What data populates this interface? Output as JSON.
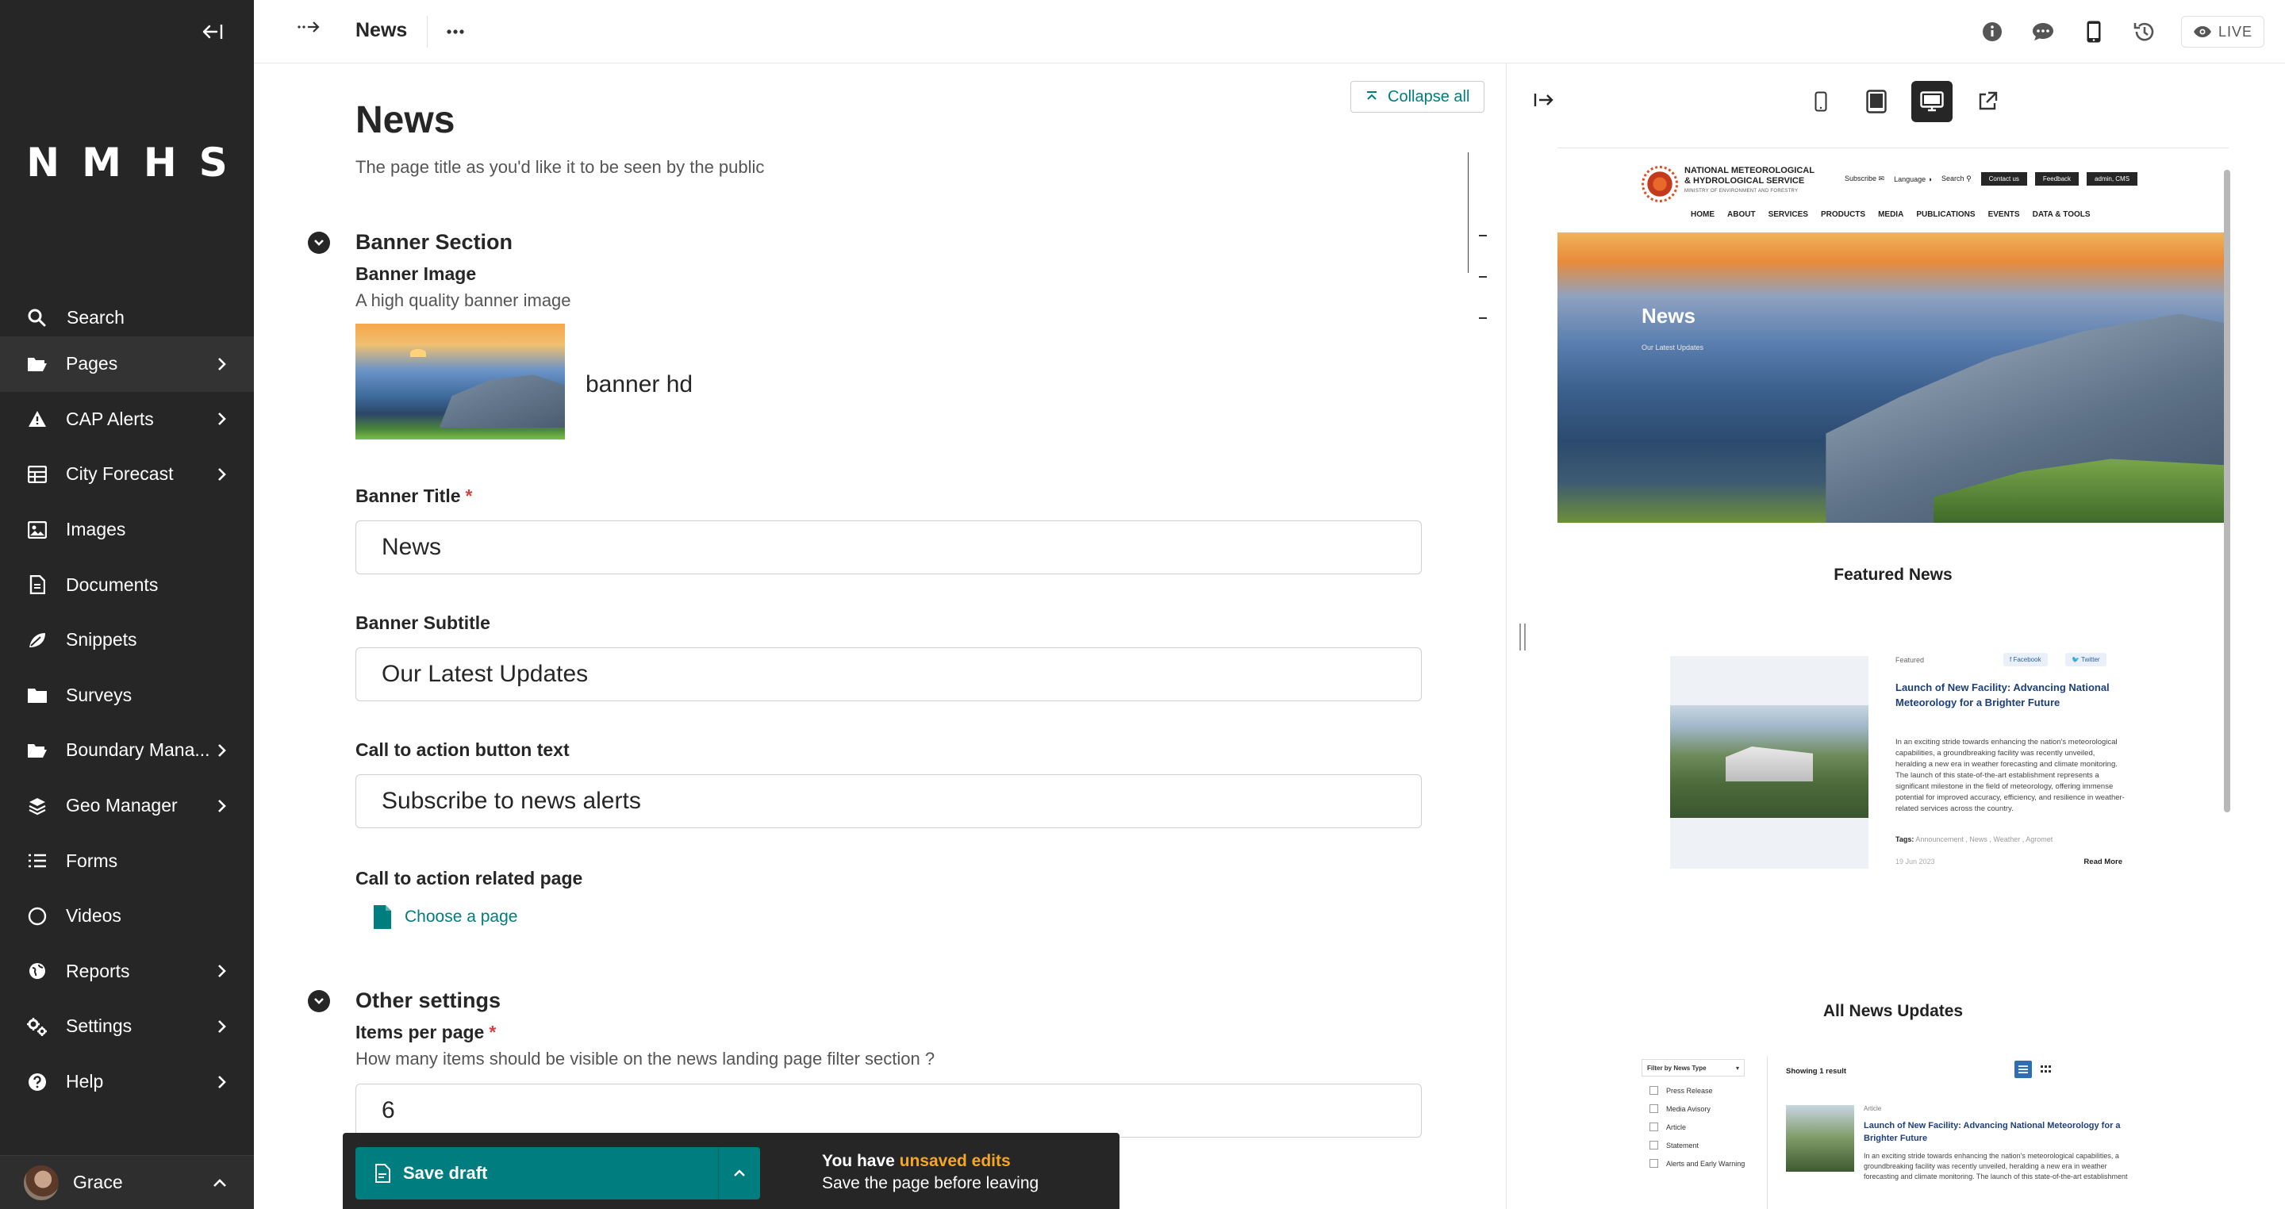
{
  "sidebar": {
    "logo": "NMHS",
    "search_label": "Search",
    "items": [
      {
        "label": "Pages",
        "icon": "folder-open-icon",
        "has_children": true
      },
      {
        "label": "CAP Alerts",
        "icon": "warning-icon",
        "has_children": true
      },
      {
        "label": "City Forecast",
        "icon": "table-icon",
        "has_children": true
      },
      {
        "label": "Images",
        "icon": "image-icon",
        "has_children": false
      },
      {
        "label": "Documents",
        "icon": "document-icon",
        "has_children": false
      },
      {
        "label": "Snippets",
        "icon": "snippet-icon",
        "has_children": false
      },
      {
        "label": "Surveys",
        "icon": "folder-icon",
        "has_children": false
      },
      {
        "label": "Boundary Mana...",
        "icon": "folder-open-icon",
        "has_children": true
      },
      {
        "label": "Geo Manager",
        "icon": "layers-icon",
        "has_children": true
      },
      {
        "label": "Forms",
        "icon": "list-icon",
        "has_children": false
      },
      {
        "label": "Videos",
        "icon": "circle-icon",
        "has_children": false
      },
      {
        "label": "Reports",
        "icon": "globe-icon",
        "has_children": true
      },
      {
        "label": "Settings",
        "icon": "cogs-icon",
        "has_children": true
      },
      {
        "label": "Help",
        "icon": "help-icon",
        "has_children": true
      }
    ],
    "user_name": "Grace"
  },
  "topbar": {
    "title": "News",
    "live_label": "LIVE"
  },
  "editor": {
    "collapse_all": "Collapse all",
    "page_title": "News",
    "page_title_help": "The page title as you'd like it to be seen by the public",
    "banner_section": "Banner Section",
    "banner_image_label": "Banner Image",
    "banner_image_help": "A high quality banner image",
    "banner_image_name": "banner hd",
    "banner_title_label": "Banner Title",
    "banner_title_value": "News",
    "banner_subtitle_label": "Banner Subtitle",
    "banner_subtitle_value": "Our Latest Updates",
    "cta_text_label": "Call to action button text",
    "cta_text_value": "Subscribe to news alerts",
    "cta_page_label": "Call to action related page",
    "choose_page": "Choose a page",
    "other_settings": "Other settings",
    "items_per_page_label": "Items per page",
    "items_per_page_help": "How many items should be visible on the news landing page filter section ?",
    "items_per_page_value": "6",
    "required_marker": "*"
  },
  "savebar": {
    "save_label": "Save draft",
    "msg_prefix": "You have ",
    "msg_highlight": "unsaved edits",
    "msg_sub": "Save the page before leaving"
  },
  "preview": {
    "site": {
      "org_line1": "NATIONAL METEOROLOGICAL",
      "org_line2": "& HYDROLOGICAL SERVICE",
      "org_ministry": "MINISTRY OF ENVIRONMENT AND FORESTRY",
      "util_subscribe": "Subscribe ✉",
      "util_language": "Language ◑",
      "util_search": "Search ⚲",
      "util_contact": "Contact us",
      "util_feedback": "Feedback",
      "util_admin": "admin, CMS",
      "nav": [
        "HOME",
        "ABOUT",
        "SERVICES",
        "PRODUCTS",
        "MEDIA",
        "PUBLICATIONS",
        "EVENTS",
        "DATA & TOOLS"
      ],
      "hero_title": "News",
      "hero_subtitle": "Our Latest Updates",
      "featured_title": "Featured News",
      "card_tag": "Featured",
      "card_facebook": "f Facebook",
      "card_twitter": "🐦 Twitter",
      "card_title": "Launch of New Facility: Advancing National Meteorology for a Brighter Future",
      "card_body": "In an exciting stride towards enhancing the nation's meteorological capabilities, a groundbreaking facility was recently unveiled, heralding a new era in weather forecasting and climate monitoring. The launch of this state-of-the-art establishment represents a significant milestone in the field of meteorology, offering immense potential for improved accuracy, efficiency, and resilience in weather-related services across the country.",
      "card_tags_label": "Tags:",
      "card_tags": "Announcement , News , Weather , Agromet",
      "card_date": "19 Jun 2023",
      "card_more": "Read More",
      "all_title": "All News Updates",
      "filter_label": "Filter by News Type",
      "filter_options": [
        "Press Release",
        "Media Avisory",
        "Article",
        "Statement",
        "Alerts and Early Warning"
      ],
      "showing": "Showing 1 result",
      "list_meta": "Article",
      "list_title": "Launch of New Facility: Advancing National Meteorology for a Brighter Future",
      "list_body": "In an exciting stride towards enhancing the nation's meteorological capabilities, a groundbreaking facility was recently unveiled, heralding a new era in weather forecasting and climate monitoring. The launch of this state-of-the-art establishment"
    }
  },
  "colors": {
    "sidebar_bg": "#262626",
    "accent_teal": "#007d7e",
    "unsaved_highlight": "#f5a623",
    "required_red": "#cd4444"
  }
}
